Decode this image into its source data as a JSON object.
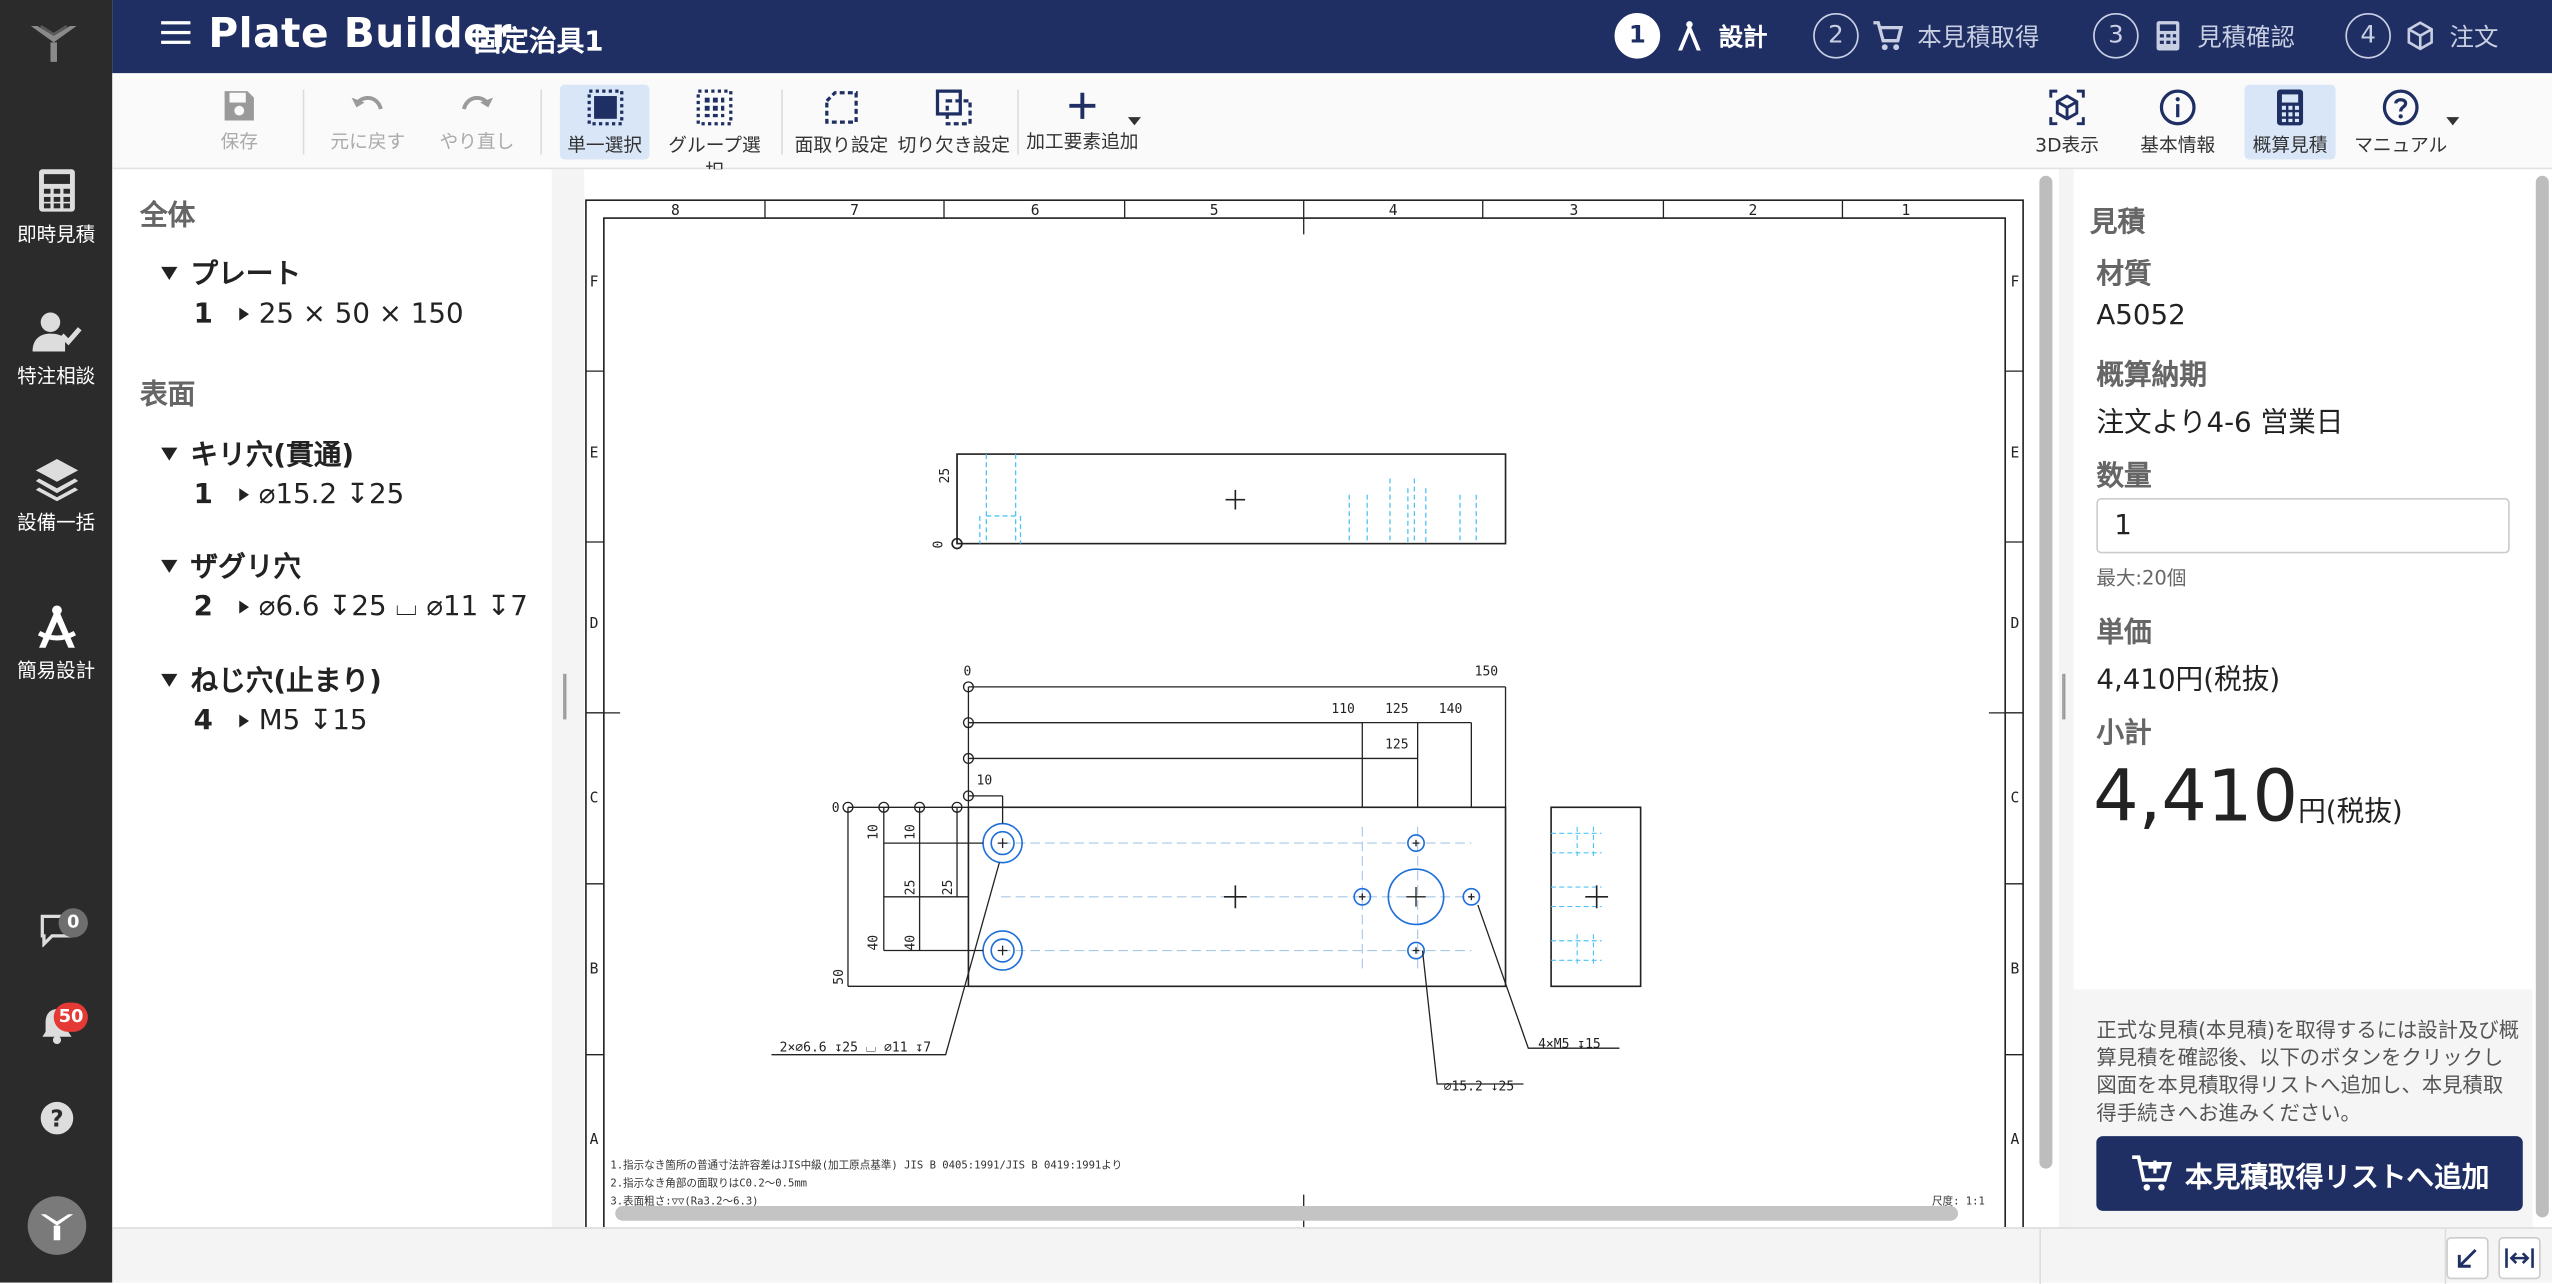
{
  "app": {
    "title": "Plate Builder",
    "document_title": "固定治具1"
  },
  "colors": {
    "topbar": "#1f2f63",
    "rail": "#2b2b2b",
    "accent_blue": "#1e6fd9",
    "badge_gray": "#6e6e6e",
    "badge_red": "#e53935"
  },
  "steps": [
    {
      "num": "1",
      "label": "設計",
      "icon": "compass-icon",
      "active": true
    },
    {
      "num": "2",
      "label": "本見積取得",
      "icon": "cart-icon",
      "active": false
    },
    {
      "num": "3",
      "label": "見積確認",
      "icon": "calculator-icon",
      "active": false
    },
    {
      "num": "4",
      "label": "注文",
      "icon": "box-icon",
      "active": false
    }
  ],
  "rail": {
    "items": [
      {
        "label": "即時見積",
        "icon": "calculator-icon"
      },
      {
        "label": "特注相談",
        "icon": "user-check-icon"
      },
      {
        "label": "設備一括",
        "icon": "layers-icon"
      },
      {
        "label": "簡易設計",
        "icon": "compass-icon",
        "active": true
      }
    ],
    "chat_badge": "0",
    "bell_badge": "50"
  },
  "toolbar": {
    "save": "保存",
    "undo": "元に戻す",
    "redo": "やり直し",
    "single_select": "単一選択",
    "group_select": "グループ選択",
    "chamfer": "面取り設定",
    "notch": "切り欠き設定",
    "add_feature": "加工要素追加",
    "view_3d": "3D表示",
    "basic_info": "基本情報",
    "estimate": "概算見積",
    "manual": "マニュアル"
  },
  "tree": {
    "section_whole": "全体",
    "plate_group": "プレート",
    "plate_row": {
      "count": "1",
      "label": "25 × 50 × 150"
    },
    "section_surface": "表面",
    "groups": [
      {
        "name": "キリ穴(貫通)",
        "count": "1",
        "label": "⌀15.2 ↧25"
      },
      {
        "name": "ザグリ穴",
        "count": "2",
        "label": "⌀6.6 ↧25 ⌴ ⌀11 ↧7"
      },
      {
        "name": "ねじ穴(止まり)",
        "count": "4",
        "label": "M5 ↧15"
      }
    ]
  },
  "drawing": {
    "border_top_labels": [
      "8",
      "7",
      "6",
      "5",
      "4",
      "3",
      "2",
      "1"
    ],
    "border_side_labels": [
      "F",
      "E",
      "D",
      "C",
      "B",
      "A"
    ],
    "top_view_dims": {
      "height": "25",
      "zero": "0"
    },
    "plan_dims_top": {
      "zero": "0",
      "l150": "150",
      "l110": "110",
      "l125a": "125",
      "l140": "140",
      "l125b": "125",
      "l10": "10"
    },
    "plan_dims_left": {
      "zero": "0",
      "a10": "10",
      "b10": "10",
      "a25": "25",
      "b25": "25",
      "a40": "40",
      "b40": "40",
      "l50": "50"
    },
    "callouts": {
      "counterbore": "2×⌀6.6 ↧25 ⌴ ⌀11 ↧7",
      "drill": "⌀15.2 ↧25",
      "tap": "4×M5 ↧15"
    },
    "notes": [
      "1.指示なき箇所の普通寸法許容差はJIS中級(加工原点基準) JIS B 0405:1991/JIS B 0419:1991より",
      "2.指示なき角部の面取りはC0.2〜0.5mm",
      "3.表面粗さ:▽▽(Ra3.2〜6.3)"
    ],
    "scale": "尺度: 1:1"
  },
  "estimate": {
    "heading": "見積",
    "material_label": "材質",
    "material": "A5052",
    "lead_time_label": "概算納期",
    "lead_time": "注文より4-6 営業日",
    "quantity_label": "数量",
    "quantity": "1",
    "quantity_hint": "最大:20個",
    "unit_price_label": "単価",
    "unit_price": "4,410円(税抜)",
    "subtotal_label": "小計",
    "subtotal_value": "4,410",
    "subtotal_unit": "円(税抜)",
    "note": "正式な見積(本見積)を取得するには設計及び概算見積を確認後、以下のボタンをクリックし図面を本見積取得リストへ追加し、本見積取得手続きへお進みください。",
    "add_button": "本見積取得リストへ追加"
  }
}
